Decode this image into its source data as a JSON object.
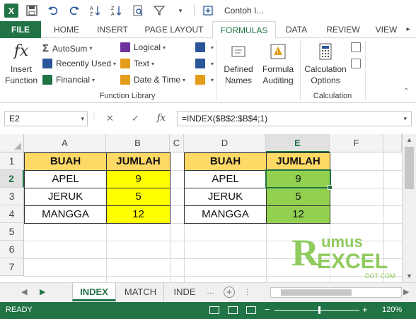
{
  "window": {
    "title": "Contoh I..."
  },
  "ribbon_tabs": [
    "FILE",
    "HOME",
    "INSERT",
    "PAGE LAYOUT",
    "FORMULAS",
    "DATA",
    "REVIEW",
    "VIEW"
  ],
  "active_tab": "FORMULAS",
  "ribbon": {
    "insert_function": {
      "line1": "Insert",
      "line2": "Function"
    },
    "autosum": "AutoSum",
    "recently_used": "Recently Used",
    "financial": "Financial",
    "logical": "Logical",
    "text": "Text",
    "date_time": "Date & Time",
    "defined_names": {
      "line1": "Defined",
      "line2": "Names"
    },
    "formula_auditing": {
      "line1": "Formula",
      "line2": "Auditing"
    },
    "calc_options": {
      "line1": "Calculation",
      "line2": "Options"
    },
    "group_function_library": "Function Library",
    "group_calculation": "Calculation"
  },
  "formula_bar": {
    "name_box": "E2",
    "cancel": "✕",
    "enter": "✓",
    "fx": "fx",
    "formula": "=INDEX($B$2:$B$4;1)"
  },
  "columns": [
    "A",
    "B",
    "C",
    "D",
    "E",
    "F"
  ],
  "selected_column": "E",
  "rows": [
    "1",
    "2",
    "3",
    "4",
    "5",
    "6",
    "7"
  ],
  "selected_row": "2",
  "table_left": {
    "headers": [
      "BUAH",
      "JUMLAH"
    ],
    "rows": [
      [
        "APEL",
        "9"
      ],
      [
        "JERUK",
        "5"
      ],
      [
        "MANGGA",
        "12"
      ]
    ]
  },
  "table_right": {
    "headers": [
      "BUAH",
      "JUMLAH"
    ],
    "rows": [
      [
        "APEL",
        "9"
      ],
      [
        "JERUK",
        "5"
      ],
      [
        "MANGGA",
        "12"
      ]
    ]
  },
  "watermark": {
    "line1_big": "R",
    "line1_rest": "umus",
    "line2": "EXCEL",
    "line3": "DOT COM"
  },
  "sheets": [
    "INDEX",
    "MATCH",
    "INDE"
  ],
  "active_sheet": "INDEX",
  "status": {
    "ready": "READY",
    "zoom": "120%"
  },
  "colors": {
    "excel_green": "#217346",
    "header_fill": "#ffd966",
    "yellow_fill": "#ffff00",
    "green_fill": "#92d050"
  }
}
